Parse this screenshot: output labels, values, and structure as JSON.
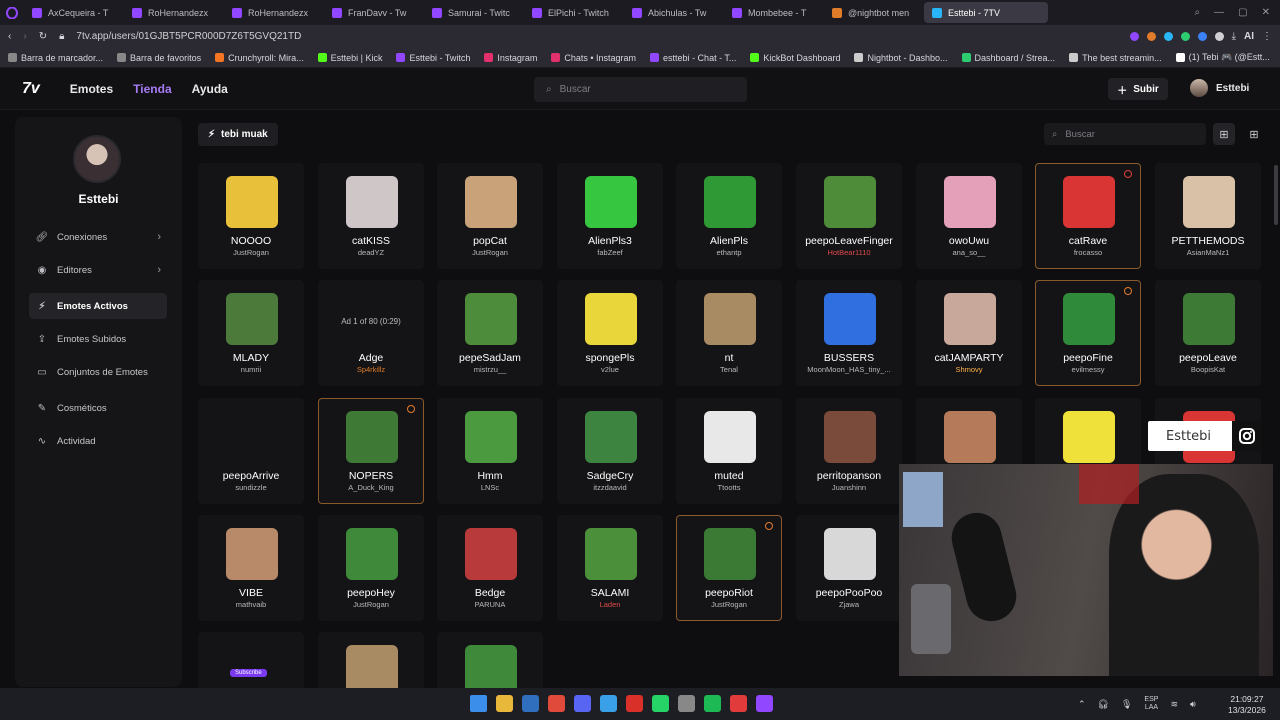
{
  "browser": {
    "tabs": [
      {
        "label": "AxCequeira - T",
        "color": "#9146ff"
      },
      {
        "label": "RoHernandezx",
        "color": "#9146ff"
      },
      {
        "label": "RoHernandezx",
        "color": "#9146ff"
      },
      {
        "label": "FranDavv - Tw",
        "color": "#9146ff"
      },
      {
        "label": "Samurai - Twitc",
        "color": "#9146ff"
      },
      {
        "label": "ElPichi - Twitch",
        "color": "#9146ff"
      },
      {
        "label": "Abichulas - Tw",
        "color": "#9146ff"
      },
      {
        "label": "Mombebee - T",
        "color": "#9146ff"
      },
      {
        "label": "@nightbot men",
        "color": "#e07b2a"
      },
      {
        "label": "Esttebi - 7TV",
        "color": "#29b6f6",
        "active": true
      }
    ],
    "url": "7tv.app/users/01GJBT5PCR000D7Z6T5GVQ21TD",
    "bookmarks": [
      {
        "label": "Barra de marcador...",
        "color": "#888"
      },
      {
        "label": "Barra de favoritos",
        "color": "#888"
      },
      {
        "label": "Crunchyroll: Mira...",
        "color": "#f47521"
      },
      {
        "label": "Esttebi | Kick",
        "color": "#53fc18"
      },
      {
        "label": "Esttebi - Twitch",
        "color": "#9146ff"
      },
      {
        "label": "Instagram",
        "color": "#e1306c"
      },
      {
        "label": "Chats • Instagram",
        "color": "#e1306c"
      },
      {
        "label": "esttebi - Chat - T...",
        "color": "#9146ff"
      },
      {
        "label": "KickBot Dashboard",
        "color": "#53fc18"
      },
      {
        "label": "Nightbot - Dashbo...",
        "color": "#cccccc"
      },
      {
        "label": "Dashboard / Strea...",
        "color": "#2ecc71"
      },
      {
        "label": "The best streamin...",
        "color": "#cccccc"
      },
      {
        "label": "(1) Tebi 🎮 (@Estt...",
        "color": "#ffffff"
      }
    ]
  },
  "topnav": {
    "brand": "7v",
    "links": {
      "emotes": "Emotes",
      "tienda": "Tienda",
      "ayuda": "Ayuda"
    },
    "search_placeholder": "Buscar",
    "upload": "Subir",
    "username": "Esttebi"
  },
  "sidebar": {
    "name": "Esttebi",
    "items": [
      {
        "label": "Conexiones",
        "icon": "link-icon",
        "chevron": true
      },
      {
        "label": "Editores",
        "icon": "user-circle-icon",
        "chevron": true
      },
      {
        "label": "Emotes Activos",
        "icon": "bolt-icon",
        "active": true
      },
      {
        "label": "Emotes Subidos",
        "icon": "upload-icon"
      },
      {
        "label": "Conjuntos de Emotes",
        "icon": "folder-icon"
      },
      {
        "label": "Cosméticos",
        "icon": "brush-icon"
      },
      {
        "label": "Actividad",
        "icon": "activity-icon"
      }
    ]
  },
  "emote_set": {
    "name": "tebi muak",
    "search_placeholder": "Buscar"
  },
  "emotes": [
    {
      "name": "NOOOO",
      "author": "JustRogan",
      "color": "#e8c03a"
    },
    {
      "name": "catKISS",
      "author": "deadYZ",
      "color": "#cfc6c8"
    },
    {
      "name": "popCat",
      "author": "JustRogan",
      "color": "#c9a27a"
    },
    {
      "name": "AlienPls3",
      "author": "fabZeef",
      "color": "#36c640"
    },
    {
      "name": "AlienPls",
      "author": "ethantp",
      "color": "#2f9a35"
    },
    {
      "name": "peepoLeaveFinger",
      "author": "HotBear1110",
      "color": "#4f8c3a",
      "author_color": "#e04a4a"
    },
    {
      "name": "owoUwu",
      "author": "ana_so__",
      "color": "#e3a0b8"
    },
    {
      "name": "catRave",
      "author": "frocasso",
      "color": "#d93535",
      "badge": "red",
      "highlight": true
    },
    {
      "name": "PETTHEMODS",
      "author": "AsianMaNz1",
      "color": "#d9c1a8"
    },
    {
      "name": "MLADY",
      "author": "numrii",
      "color": "#4b7a3a"
    },
    {
      "name": "Adge",
      "author": "Sp4rkillz",
      "ad": "Ad 1 of 80 (0:29)",
      "author_color": "#e07b2a"
    },
    {
      "name": "pepeSadJam",
      "author": "mistrzu__",
      "color": "#4d8c3b"
    },
    {
      "name": "spongePls",
      "author": "v2lue",
      "color": "#e8d63a"
    },
    {
      "name": "nt",
      "author": "Tenal",
      "color": "#a88a63"
    },
    {
      "name": "BUSSERS",
      "author": "MoonMoon_HAS_tiny_...",
      "color": "#2f6fe0"
    },
    {
      "name": "catJAMPARTY",
      "author": "Shmovy",
      "color": "#c8a89a",
      "author_color": "#ffb24a"
    },
    {
      "name": "peepoFine",
      "author": "evilmessy",
      "color": "#2f8a3a",
      "badge": "orange",
      "highlight": true
    },
    {
      "name": "peepoLeave",
      "author": "BoopisKat",
      "color": "#3c7a35"
    },
    {
      "name": "peepoArrive",
      "author": "sundizzle",
      "color": "#141416"
    },
    {
      "name": "NOPERS",
      "author": "A_Duck_King",
      "color": "#3e7a36",
      "badge": "orange",
      "highlight": true
    },
    {
      "name": "Hmm",
      "author": "LNSc",
      "color": "#4b9a3f"
    },
    {
      "name": "SadgeCry",
      "author": "itzzdaavid",
      "color": "#3c8440"
    },
    {
      "name": "muted",
      "author": "Ttootts",
      "color": "#e8e8e8"
    },
    {
      "name": "perritopanson",
      "author": "Juanshinn",
      "color": "#7a4a3a"
    },
    {
      "name": "",
      "author": "",
      "color": "#b57a5a"
    },
    {
      "name": "",
      "author": "",
      "color": "#f0e03a"
    },
    {
      "name": "",
      "author": "",
      "color": "#d93535"
    },
    {
      "name": "VIBE",
      "author": "mathvaib",
      "color": "#b98a6a"
    },
    {
      "name": "peepoHey",
      "author": "JustRogan",
      "color": "#3f8a3a"
    },
    {
      "name": "Bedge",
      "author": "PARUNA",
      "color": "#b83a3a"
    },
    {
      "name": "SALAMI",
      "author": "Laden",
      "color": "#4b8f3a",
      "author_color": "#e04a4a"
    },
    {
      "name": "peepoRiot",
      "author": "JustRogan",
      "color": "#3a7a35",
      "badge": "orange",
      "highlight": true
    },
    {
      "name": "peepoPooPoo",
      "author": "Zjawa",
      "color": "#d8d8d8"
    },
    {
      "name": "",
      "author": "",
      "color": "#c9a27a"
    },
    {
      "name": "",
      "author": "",
      "color": "#3e7a36",
      "badge": "orange",
      "highlight": true
    },
    {
      "name": "",
      "author": "",
      "color": "#4b9a3f"
    },
    {
      "name": "",
      "author": "",
      "color": "#7a3bf0",
      "subscribe": "Subscribe"
    },
    {
      "name": "",
      "author": "",
      "color": "#a88a63"
    },
    {
      "name": "",
      "author": "",
      "color": "#3f8a3a"
    }
  ],
  "overlay": {
    "text": "Esttebi",
    "icon": "instagram-icon"
  },
  "taskbar": {
    "apps": [
      "#3b8eea",
      "#e8b83a",
      "#2f6fbd",
      "#e04a3a",
      "#5865f2",
      "#3aa0e8",
      "#d9302a",
      "#25d366",
      "#888888",
      "#1db954",
      "#e23b3b",
      "#9146ff"
    ],
    "lang_top": "ESP",
    "lang_bottom": "LAA",
    "time": "21:09:27",
    "date": "13/3/2026"
  }
}
